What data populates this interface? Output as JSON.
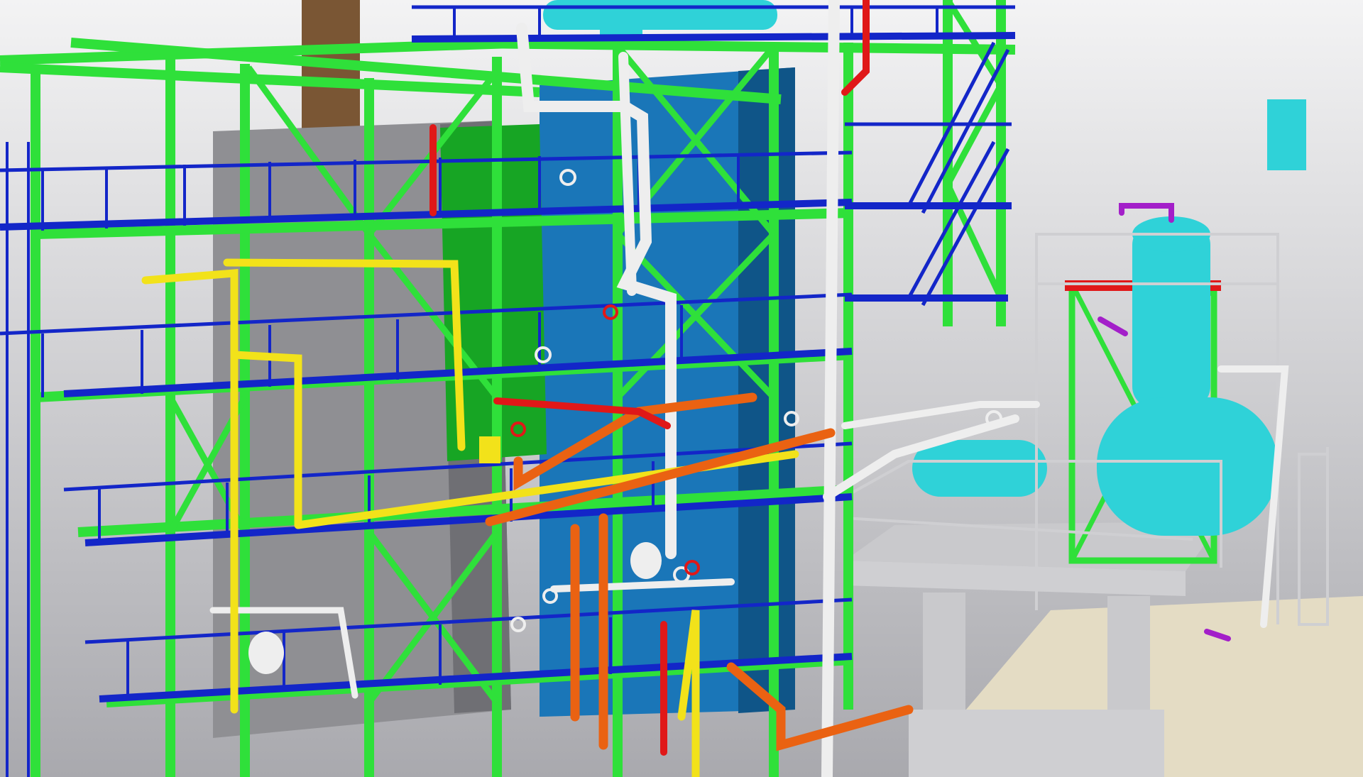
{
  "scene": {
    "subject": "industrial-plant-3d-model",
    "palette": {
      "background_top": "#f3f3f4",
      "background_bottom": "#a9a9ae",
      "structure_green": "#2fe03a",
      "structure_green_dark": "#17a524",
      "platform_blue": "#1326c8",
      "platform_blue_dark": "#0b1480",
      "wall_grey": "#8f8f93",
      "wall_grey_dark": "#6f6f74",
      "vessel_blue": "#1a76b8",
      "vessel_blue_dark": "#0f5588",
      "equipment_cyan": "#2fd2d8",
      "pipe_white": "#eeeeee",
      "pipe_yellow": "#f2e21a",
      "pipe_orange": "#ea6212",
      "pipe_red": "#e01818",
      "pipe_purple": "#a31fc9",
      "concrete": "#c9c9cc",
      "ground": "#e4dcc4",
      "chimney_brown": "#7a5634",
      "railing_grey": "#cfcfd2"
    }
  }
}
